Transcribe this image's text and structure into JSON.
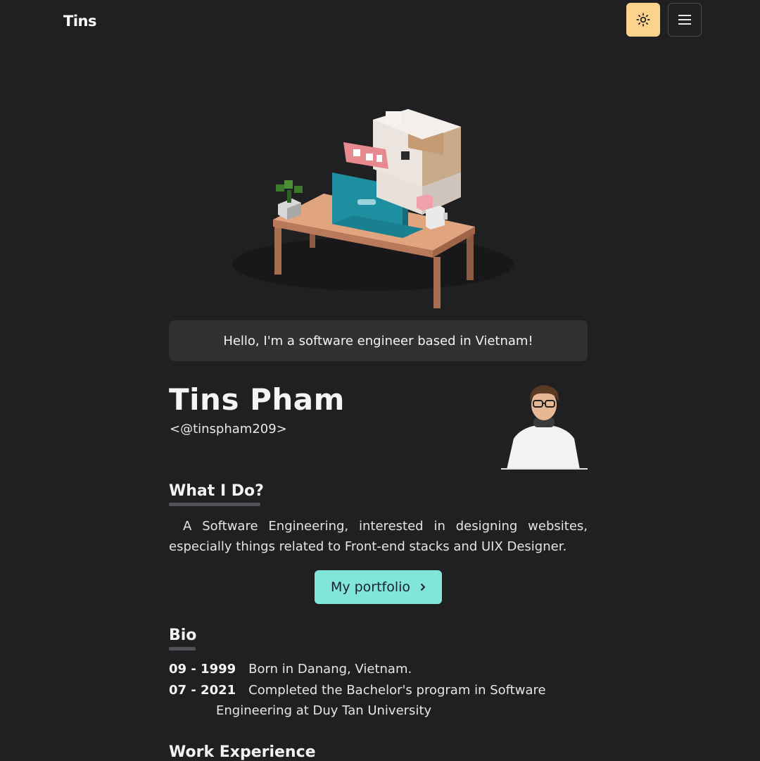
{
  "nav": {
    "logo": "Tins",
    "theme_icon": "sun-icon",
    "menu_icon": "hamburger-icon"
  },
  "hero": {
    "image": "voxel-dog-at-desk-illustration"
  },
  "greeting": "Hello, I'm a software engineer based in Vietnam!",
  "profile": {
    "name": "Tins Pham",
    "handle": "<@tinspham209>"
  },
  "what_i_do": {
    "title": "What I Do?",
    "description": "A Software Engineering, interested in designing websites, especially things related to Front-end stacks and UIX Designer."
  },
  "portfolio_button": {
    "label": "My portfolio",
    "icon": "chevron-right-icon"
  },
  "bio": {
    "title": "Bio",
    "entries": [
      {
        "year": "09 - 1999",
        "text": "Born in Danang, Vietnam.",
        "cont": ""
      },
      {
        "year": "07 - 2021",
        "text": "Completed the Bachelor's program in Software",
        "cont": "Engineering at Duy Tan University"
      }
    ]
  },
  "work_experience": {
    "title": "Work Experience"
  },
  "colors": {
    "background": "#202023",
    "theme_button": "#fbd38d",
    "accent": "#81e6d9",
    "greeting_bg": "#313134"
  }
}
